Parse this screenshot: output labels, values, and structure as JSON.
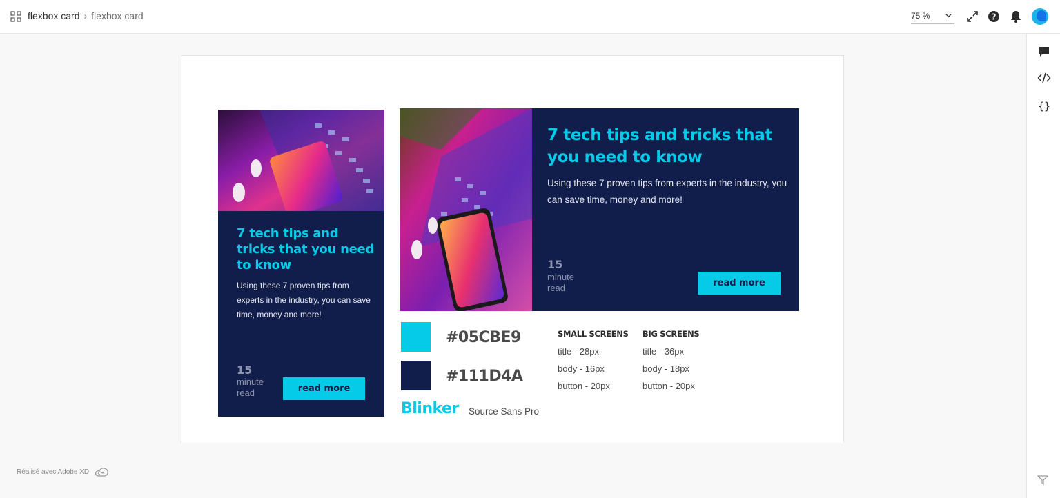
{
  "header": {
    "breadcrumb": [
      "flexbox card",
      "flexbox card"
    ],
    "zoom": "75 %"
  },
  "cards": {
    "small": {
      "title": "7 tech tips and tricks that you need to know",
      "body": "Using these 7 proven tips from experts in the industry, you can save time, money and more!",
      "minutes": "15",
      "minutes_label": "minute read",
      "button": "read more"
    },
    "large": {
      "title": "7 tech tips and tricks that you need to know",
      "body": "Using these 7 proven tips from experts in the industry, you can save time, money and more!",
      "minutes": "15",
      "minutes_label": "minute read",
      "button": "read more"
    }
  },
  "styleguide": {
    "colors": [
      {
        "hex": "#05CBE9",
        "value": "#05cbe9"
      },
      {
        "hex": "#111D4A",
        "value": "#111d4a"
      }
    ],
    "fonts": {
      "heading": "Blinker",
      "body": "Source Sans Pro"
    },
    "small_screens": {
      "heading": "SMALL SCREENS",
      "title": "title - 28px",
      "body": "body - 16px",
      "button": "button - 20px"
    },
    "big_screens": {
      "heading": "BIG SCREENS",
      "title": "title - 36px",
      "body": "body - 18px",
      "button": "button - 20px"
    }
  },
  "footer": {
    "made_with": "Réalisé avec Adobe XD"
  },
  "icons": [
    "grid-icon",
    "chevron-down-icon",
    "expand-icon",
    "help-icon",
    "bell-icon",
    "avatar",
    "comment-icon",
    "code-icon",
    "braces-icon",
    "creative-cloud-icon",
    "filter-icon"
  ]
}
